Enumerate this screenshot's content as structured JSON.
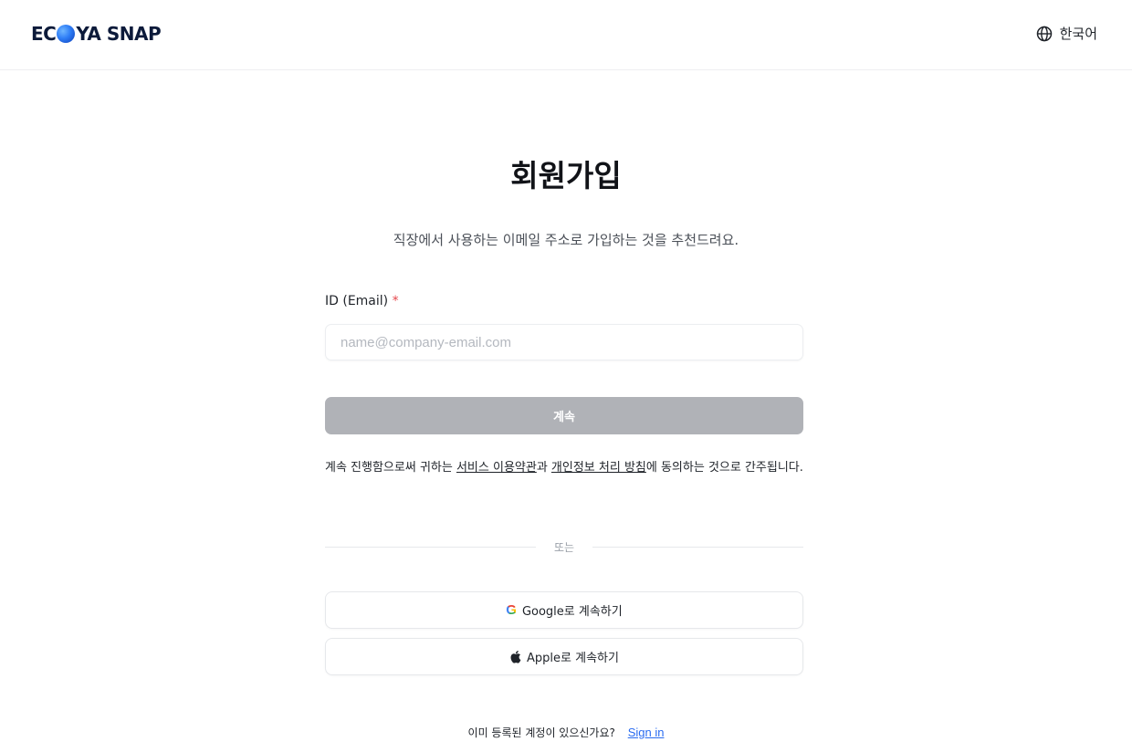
{
  "header": {
    "logo_prefix": "EC",
    "logo_suffix": "YA SNAP",
    "language_label": "한국어",
    "icons": {
      "logo_o": "globe-o-logo-icon",
      "language": "globe-icon"
    }
  },
  "signup": {
    "title": "회원가입",
    "subtitle": "직장에서 사용하는 이메일 주소로 가입하는 것을 추천드려요.",
    "email_label": "ID (Email)",
    "required_mark": "*",
    "email_placeholder": "name@company-email.com",
    "email_value": "",
    "continue_label": "계속",
    "terms_prefix": "계속 진행함으로써 귀하는 ",
    "terms_link": "서비스 이용약관",
    "terms_mid": "과 ",
    "privacy_link": "개인정보 처리 방침",
    "terms_suffix": "에 동의하는 것으로 간주됩니다.",
    "or_label": "또는",
    "google_icon": "G",
    "google_label": "Google로 계속하기",
    "apple_label": "Apple로 계속하기"
  },
  "footer": {
    "question": "이미 등록된 계정이 있으신가요?",
    "signin_label": "Sign in"
  },
  "colors": {
    "continue_disabled": "#b0b2b7",
    "required": "#e5484d",
    "link": "#2a6cf0"
  }
}
